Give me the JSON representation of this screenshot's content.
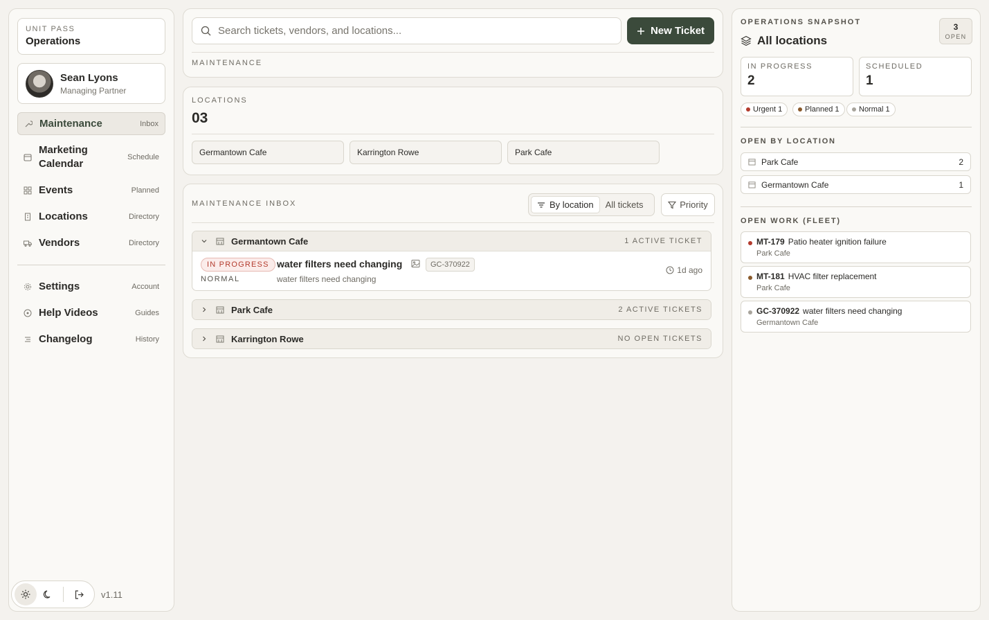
{
  "sidebar": {
    "brand_kicker": "UNIT PASS",
    "brand_title": "Operations",
    "user": {
      "name": "Sean Lyons",
      "role": "Managing Partner"
    },
    "nav": [
      {
        "label": "Maintenance",
        "meta": "Inbox",
        "icon": "wrench-icon",
        "active": true
      },
      {
        "label": "Marketing Calendar",
        "meta": "Schedule",
        "icon": "calendar-icon"
      },
      {
        "label": "Events",
        "meta": "Planned",
        "icon": "grid-icon"
      },
      {
        "label": "Locations",
        "meta": "Directory",
        "icon": "building-icon"
      },
      {
        "label": "Vendors",
        "meta": "Directory",
        "icon": "truck-icon"
      }
    ],
    "nav_secondary": [
      {
        "label": "Settings",
        "meta": "Account",
        "icon": "gear-icon"
      },
      {
        "label": "Help Videos",
        "meta": "Guides",
        "icon": "play-circle-icon"
      },
      {
        "label": "Changelog",
        "meta": "History",
        "icon": "list-icon"
      }
    ],
    "version": "v1.11"
  },
  "search": {
    "placeholder": "Search tickets, vendors, and locations..."
  },
  "new_ticket_label": "New Ticket",
  "maintenance_kicker": "MAINTENANCE",
  "locations": {
    "kicker": "LOCATIONS",
    "count": "03",
    "items": [
      "Germantown Cafe",
      "Karrington Rowe",
      "Park Cafe"
    ]
  },
  "inbox": {
    "kicker": "MAINTENANCE INBOX",
    "view_by_location": "By location",
    "view_all": "All tickets",
    "priority_label": "Priority",
    "groups": [
      {
        "name": "Germantown Cafe",
        "count": "1 ACTIVE TICKET",
        "expanded": true
      },
      {
        "name": "Park Cafe",
        "count": "2 ACTIVE TICKETS",
        "expanded": false
      },
      {
        "name": "Karrington Rowe",
        "count": "NO OPEN TICKETS",
        "expanded": false
      }
    ],
    "ticket": {
      "status": "IN PROGRESS",
      "priority": "NORMAL",
      "title": "water filters need changing",
      "code": "GC-370922",
      "description": "water filters need changing",
      "time": "1d ago"
    }
  },
  "snapshot": {
    "kicker": "OPERATIONS SNAPSHOT",
    "title": "All locations",
    "open_count": "3",
    "open_label": "OPEN",
    "in_progress_label": "IN PROGRESS",
    "in_progress_value": "2",
    "scheduled_label": "SCHEDULED",
    "scheduled_value": "1",
    "chips": [
      {
        "label": "Urgent 1",
        "color": "#b33b2d"
      },
      {
        "label": "Planned 1",
        "color": "#8a5a2b"
      },
      {
        "label": "Normal 1",
        "color": "#a8a49c"
      }
    ],
    "open_by_location_kicker": "OPEN BY LOCATION",
    "open_by_location": [
      {
        "name": "Park Cafe",
        "count": "2"
      },
      {
        "name": "Germantown Cafe",
        "count": "1"
      }
    ],
    "open_work_kicker": "OPEN WORK (FLEET)",
    "open_work": [
      {
        "code": "MT-179",
        "title": "Patio heater ignition failure",
        "location": "Park Cafe",
        "color": "#b33b2d"
      },
      {
        "code": "MT-181",
        "title": "HVAC filter replacement",
        "location": "Park Cafe",
        "color": "#8a5a2b"
      },
      {
        "code": "GC-370922",
        "title": "water filters need changing",
        "location": "Germantown Cafe",
        "color": "#a8a49c"
      }
    ]
  }
}
